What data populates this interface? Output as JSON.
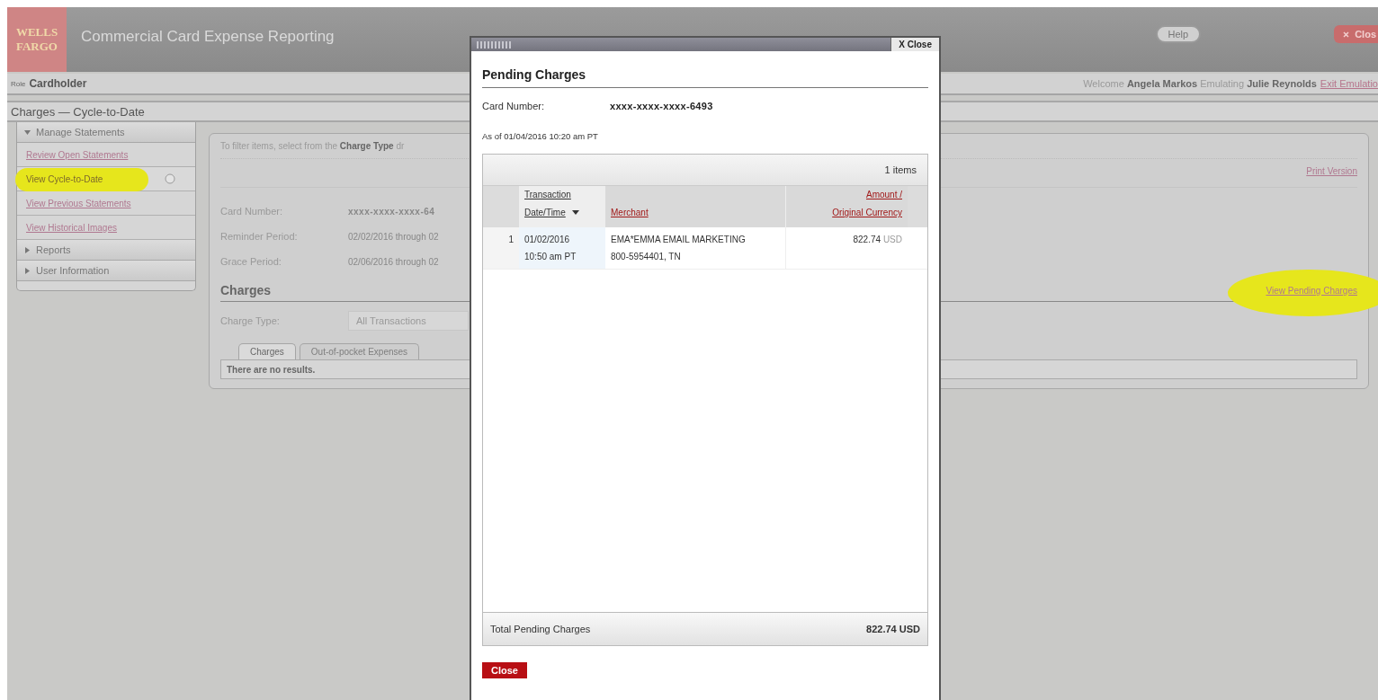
{
  "header": {
    "logo_lines": [
      "WELLS",
      "FARGO"
    ],
    "app_title": "Commercial Card Expense Reporting",
    "help_button": "Help",
    "close_button": "Clos"
  },
  "role_bar": {
    "role_label": "Role",
    "role": "Cardholder",
    "welcome": "Welcome **Angela Markos**  Emulating **Julie Reynolds**",
    "exit_link": "Exit Emulatio"
  },
  "page_title": "Charges — Cycle-to-Date",
  "sidebar": [
    {
      "kind": "section",
      "label": "Manage Statements",
      "expanded": true
    },
    {
      "kind": "link",
      "label": "Review Open Statements",
      "selected": false,
      "highlighted": false
    },
    {
      "kind": "link",
      "label": "View Cycle-to-Date",
      "selected": true,
      "highlighted": true
    },
    {
      "kind": "link",
      "label": "View Previous Statements",
      "selected": false,
      "highlighted": false
    },
    {
      "kind": "link",
      "label": "View Historical Images",
      "selected": false,
      "highlighted": false
    },
    {
      "kind": "section",
      "label": "Reports",
      "expanded": false
    },
    {
      "kind": "section",
      "label": "User Information",
      "expanded": false
    }
  ],
  "main": {
    "filter_hint": "To filter items, select from the **Charge Type** dr",
    "print_link": "Print Version",
    "fields": [
      {
        "label": "Card Number:",
        "value": "xxxx-xxxx-xxxx-64"
      },
      {
        "label": "Reminder Period:",
        "value": "02/02/2016 through 02"
      },
      {
        "label": "Grace Period:",
        "value": "02/06/2016 through 02"
      }
    ],
    "charges_heading": "Charges",
    "pending_link": "View Pending Charges",
    "pending_highlighted": true,
    "charge_type_label": "Charge Type:",
    "charge_type_value": "All Transactions",
    "tabs": [
      {
        "label": "Charges",
        "selected": true
      },
      {
        "label": "Out-of-pocket Expenses",
        "selected": false
      }
    ],
    "empty_message": "There are no results."
  },
  "dialog": {
    "close_link": "X Close",
    "title": "Pending Charges",
    "card_label": "Card Number:",
    "card_value": "xxxx-xxxx-xxxx-6493",
    "as_of": "As of 01/04/2016 10:20 am PT",
    "item_count": "1 items",
    "columns": [
      {
        "lines": [
          "Transaction",
          "Date/Time"
        ],
        "sorted": true
      },
      {
        "lines": [
          "Merchant"
        ],
        "sorted": false
      },
      {
        "lines": [
          "Amount /",
          "Original Currency"
        ],
        "sorted": false
      }
    ],
    "rows": [
      {
        "index": "1",
        "date": [
          "01/02/2016",
          "10:50 am PT"
        ],
        "merchant": [
          "EMA*EMMA EMAIL MARKETING",
          "800-5954401, TN"
        ],
        "amount": "822.74",
        "currency": "USD"
      }
    ],
    "total_label": "Total Pending Charges",
    "total_value": "822.74 USD",
    "close_button": "Close"
  }
}
